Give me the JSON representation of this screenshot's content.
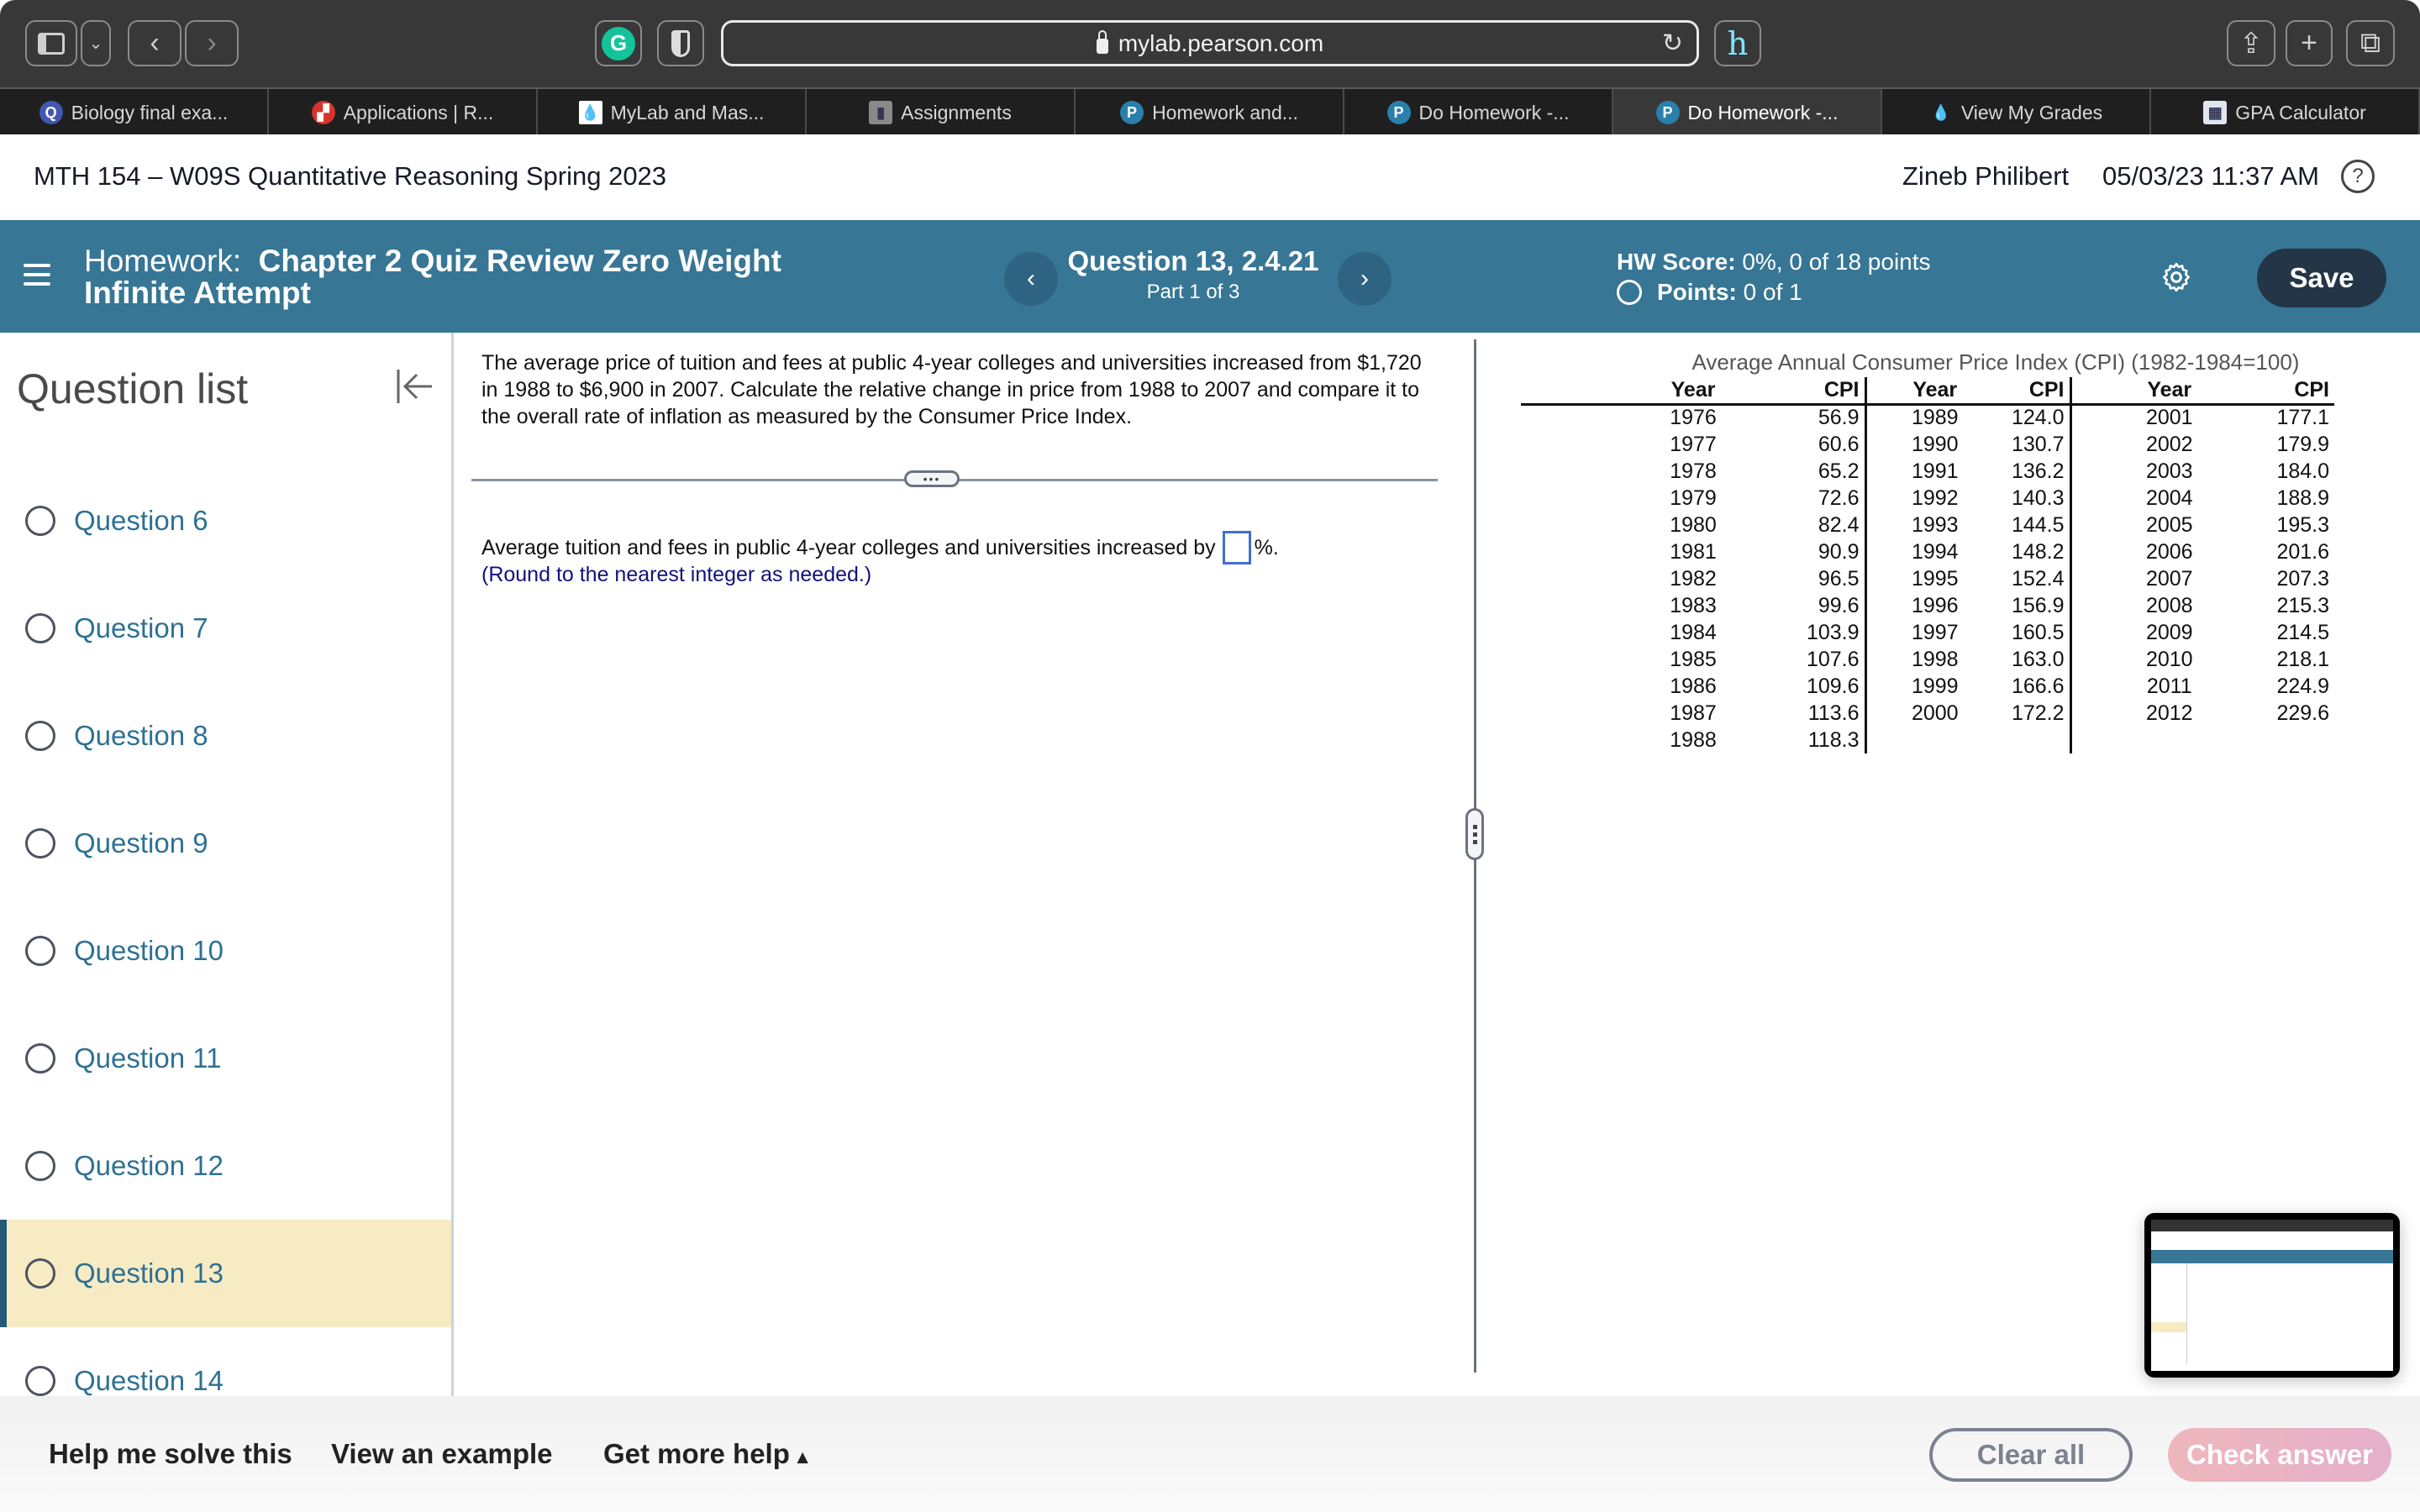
{
  "browser": {
    "url": "mylab.pearson.com",
    "tabs": [
      {
        "label": "Biology final exa...",
        "icon": "quizlet-icon",
        "active": false
      },
      {
        "label": "Applications | R...",
        "icon": "red-logo-icon",
        "active": false
      },
      {
        "label": "MyLab and Mas...",
        "icon": "mylab-icon",
        "active": false
      },
      {
        "label": "Assignments",
        "icon": "document-icon",
        "active": false
      },
      {
        "label": "Homework and...",
        "icon": "pearson-icon",
        "active": false
      },
      {
        "label": "Do Homework -...",
        "icon": "pearson-icon",
        "active": false
      },
      {
        "label": "Do Homework -...",
        "icon": "pearson-icon",
        "active": true
      },
      {
        "label": "View My Grades",
        "icon": "flame-icon",
        "active": false
      },
      {
        "label": "GPA Calculator",
        "icon": "calculator-icon",
        "active": false
      }
    ]
  },
  "header": {
    "course": "MTH 154 – W09S Quantitative Reasoning Spring 2023",
    "user": "Zineb Philibert",
    "datetime": "05/03/23 11:37 AM",
    "help": "?"
  },
  "hwbar": {
    "label": "Homework:",
    "name": "Chapter 2 Quiz Review Zero Weight Infinite Attempt",
    "question": "Question 13, 2.4.21",
    "part": "Part 1 of 3",
    "prev": "‹",
    "next": "›",
    "score_label": "HW Score:",
    "score_value": "0%, 0 of 18 points",
    "points_label": "Points:",
    "points_value": "0 of 1",
    "save": "Save"
  },
  "sidebar": {
    "title": "Question list",
    "current": "Question 13",
    "items": [
      {
        "label": "Question 6"
      },
      {
        "label": "Question 7"
      },
      {
        "label": "Question 8"
      },
      {
        "label": "Question 9"
      },
      {
        "label": "Question 10"
      },
      {
        "label": "Question 11"
      },
      {
        "label": "Question 12"
      },
      {
        "label": "Question 13"
      },
      {
        "label": "Question 14"
      }
    ]
  },
  "question": {
    "text": "The average price of tuition and fees at public 4-year colleges and universities increased from $1,720 in 1988 to $6,900 in 2007. Calculate the relative change in price from 1988 to 2007 and compare it to the overall rate of inflation as measured by the Consumer Price Index.",
    "answer_prefix": "Average tuition and fees in public 4-year colleges and universities increased by",
    "answer_value": "",
    "answer_suffix": "%.",
    "note": "(Round to the nearest integer as needed.)",
    "divider_handle": "•••"
  },
  "cpi": {
    "title": "Average Annual Consumer Price Index (CPI) (1982-1984=100)",
    "headers": [
      "Year",
      "CPI",
      "Year",
      "CPI",
      "Year",
      "CPI"
    ],
    "col1": [
      [
        "1976",
        "56.9"
      ],
      [
        "1977",
        "60.6"
      ],
      [
        "1978",
        "65.2"
      ],
      [
        "1979",
        "72.6"
      ],
      [
        "1980",
        "82.4"
      ],
      [
        "1981",
        "90.9"
      ],
      [
        "1982",
        "96.5"
      ],
      [
        "1983",
        "99.6"
      ],
      [
        "1984",
        "103.9"
      ],
      [
        "1985",
        "107.6"
      ],
      [
        "1986",
        "109.6"
      ],
      [
        "1987",
        "113.6"
      ],
      [
        "1988",
        "118.3"
      ]
    ],
    "col2": [
      [
        "1989",
        "124.0"
      ],
      [
        "1990",
        "130.7"
      ],
      [
        "1991",
        "136.2"
      ],
      [
        "1992",
        "140.3"
      ],
      [
        "1993",
        "144.5"
      ],
      [
        "1994",
        "148.2"
      ],
      [
        "1995",
        "152.4"
      ],
      [
        "1996",
        "156.9"
      ],
      [
        "1997",
        "160.5"
      ],
      [
        "1998",
        "163.0"
      ],
      [
        "1999",
        "166.6"
      ],
      [
        "2000",
        "172.2"
      ]
    ],
    "col3": [
      [
        "2001",
        "177.1"
      ],
      [
        "2002",
        "179.9"
      ],
      [
        "2003",
        "184.0"
      ],
      [
        "2004",
        "188.9"
      ],
      [
        "2005",
        "195.3"
      ],
      [
        "2006",
        "201.6"
      ],
      [
        "2007",
        "207.3"
      ],
      [
        "2008",
        "215.3"
      ],
      [
        "2009",
        "214.5"
      ],
      [
        "2010",
        "218.1"
      ],
      [
        "2011",
        "224.9"
      ],
      [
        "2012",
        "229.6"
      ]
    ]
  },
  "footer": {
    "help_solve": "Help me solve this",
    "view_example": "View an example",
    "more_help": "Get more help",
    "more_help_caret": "▴",
    "clear_all": "Clear all",
    "check_answer": "Check answer"
  },
  "colors": {
    "brand_blue": "#377695",
    "save_bg": "#233546",
    "current_question_bg": "#f7ebc3",
    "link_blue": "#2e7194",
    "check_answer_pink": "#eeb7bd"
  }
}
